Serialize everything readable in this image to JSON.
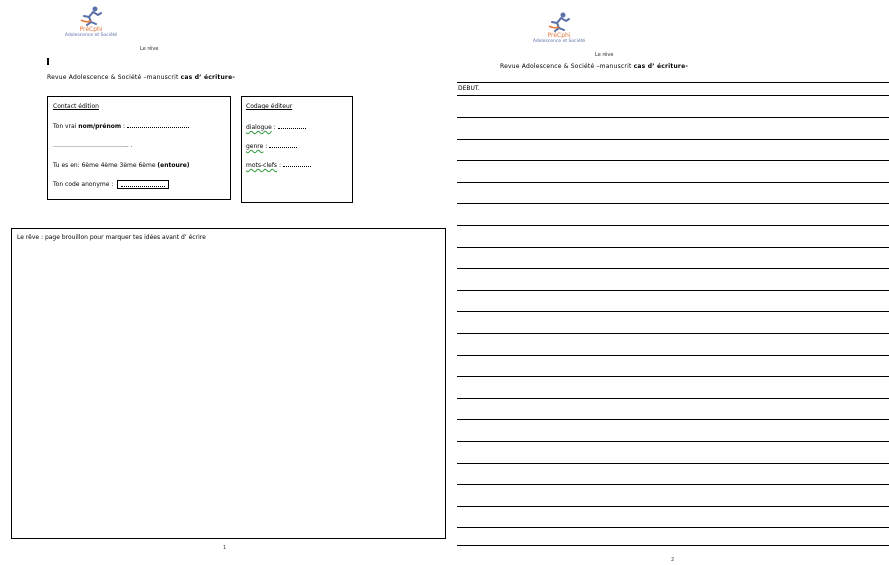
{
  "page1": {
    "logo": {
      "brand": "PréCphi",
      "subtitle": "Adolescence et Société"
    },
    "header_small": "Le rêve",
    "revue_line": {
      "prefix": "Revue Adolescence & Société –manuscrit ",
      "bold": "cas d’ écriture-"
    },
    "contact_box": {
      "title": "Contact édition",
      "name_label": "Ton vrai ",
      "name_bold": "nom/prénom",
      "name_suffix": " :",
      "dots_line": "……………………………….. .",
      "class_label": "Tu es en: 6ème 4ème 3ème 6ème ",
      "class_bold": "(entoure)",
      "code_label": "Ton code anonyme :"
    },
    "codage_box": {
      "title": "Codage éditeur",
      "item1": "dialogue",
      "item2": "genre",
      "item3": "mots-clefs"
    },
    "brouillon_label": "Le rêve : page brouillon pour marquer tes idées avant d’ écrire",
    "page_number": "1"
  },
  "page2": {
    "logo": {
      "brand": "PréCphi",
      "subtitle": "Adolescence et Société"
    },
    "header_small": "Le rêve",
    "revue_line": {
      "prefix": "Revue Adolescence & Société –manuscrit ",
      "bold": "cas d’ écriture-"
    },
    "debut_label": "DEBUT.",
    "page_number": "2"
  },
  "colors": {
    "logo_orange": "#e8753a",
    "logo_blue": "#5a6fa8",
    "spellcheck_green": "#2e9a3a"
  }
}
